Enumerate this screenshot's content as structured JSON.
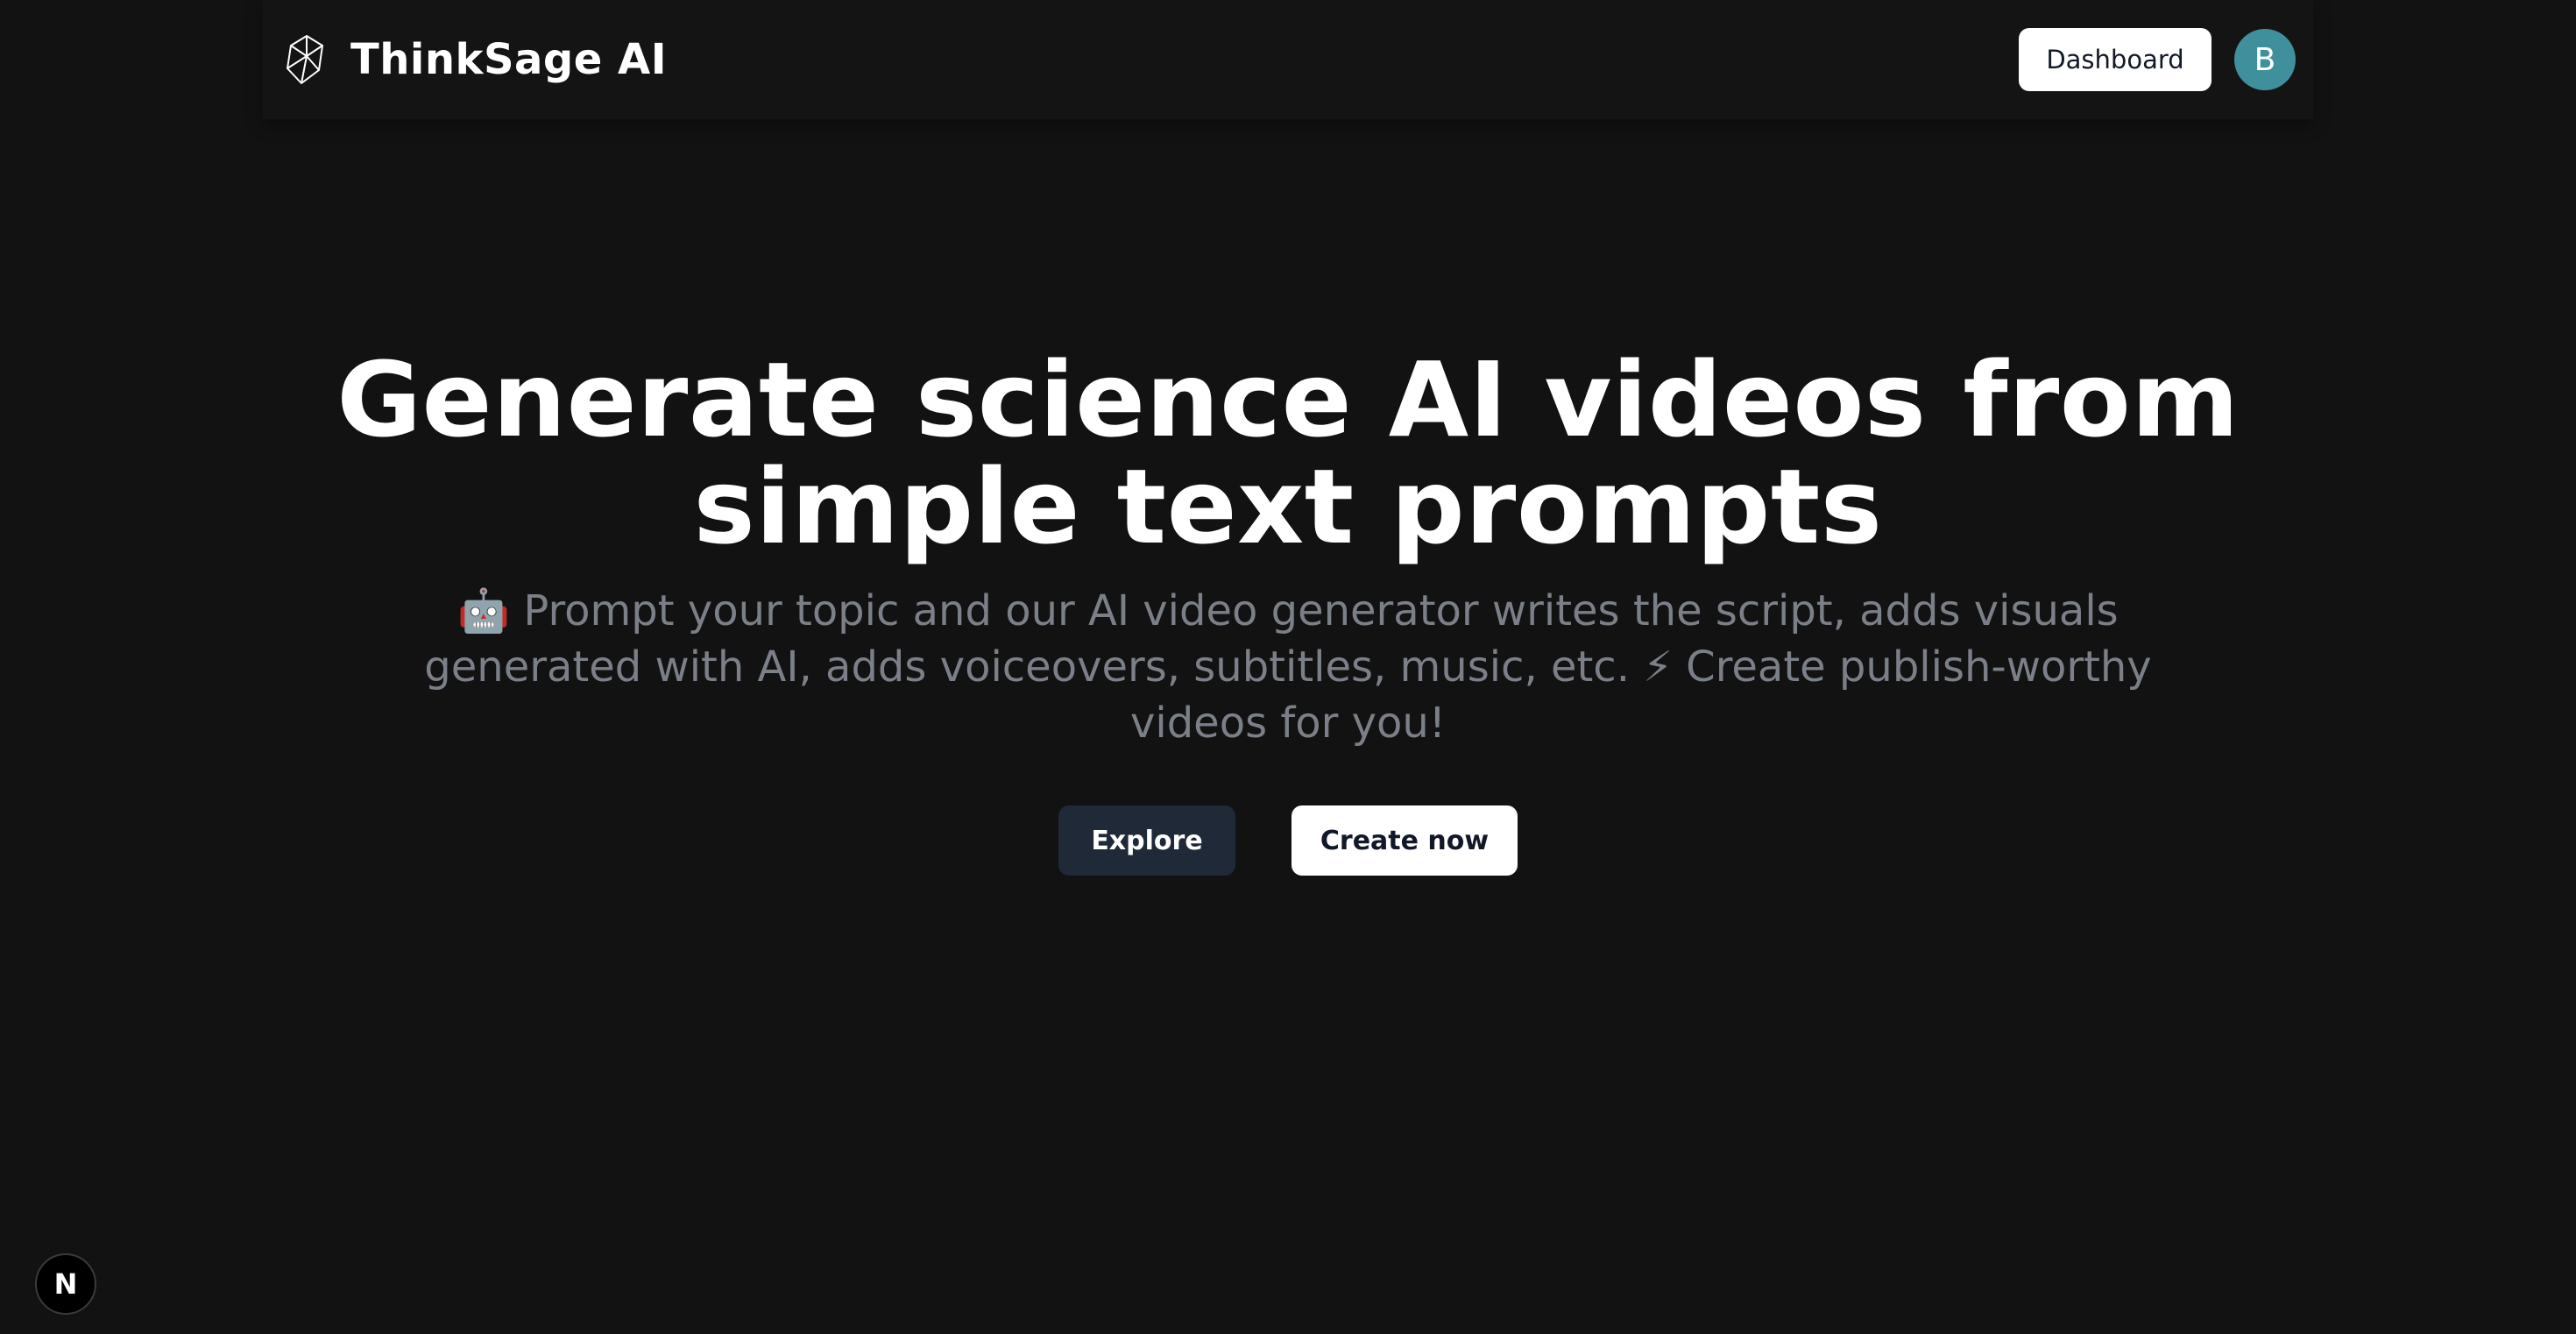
{
  "navbar": {
    "brand_name": "ThinkSage AI",
    "brand_icon": "geometric-gem-icon",
    "dashboard_label": "Dashboard",
    "avatar_initial": "B"
  },
  "hero": {
    "title_line1": "Generate science AI videos from",
    "title_line2": "simple text prompts",
    "subtitle": "🤖 Prompt your topic and our AI video generator writes the script, adds visuals generated with AI, adds voiceovers, subtitles, music, etc. ⚡ Create publish-worthy videos for you!",
    "explore_label": "Explore",
    "create_label": "Create now"
  },
  "corner_badge": {
    "label": "N",
    "icon": "nextjs-icon"
  },
  "colors": {
    "background": "#121212",
    "text_primary": "#ffffff",
    "text_muted": "#7b7f88",
    "avatar": "#3f8f9c",
    "explore_button": "#1f2937"
  }
}
